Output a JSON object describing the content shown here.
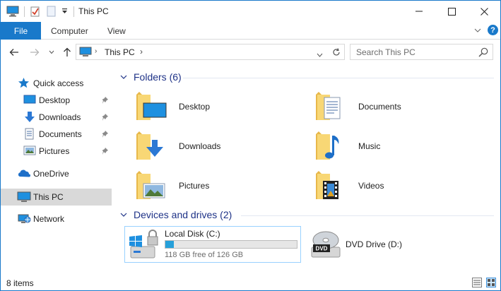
{
  "window": {
    "title": "This PC"
  },
  "window_controls": {
    "minimize": "—",
    "maximize": "☐",
    "close": "✕"
  },
  "ribbon": {
    "tabs": [
      {
        "label": "File"
      },
      {
        "label": "Computer"
      },
      {
        "label": "View"
      }
    ],
    "help": "?"
  },
  "nav": {
    "address": {
      "path": [
        "This PC"
      ]
    },
    "search": {
      "placeholder": "Search This PC"
    }
  },
  "sidebar": {
    "quick_access": "Quick access",
    "items": [
      {
        "label": "Desktop"
      },
      {
        "label": "Downloads"
      },
      {
        "label": "Documents"
      },
      {
        "label": "Pictures"
      }
    ],
    "onedrive": "OneDrive",
    "this_pc": "This PC",
    "network": "Network"
  },
  "content": {
    "folders_header": "Folders (6)",
    "folders": [
      {
        "label": "Desktop",
        "icon": "desktop-folder-icon"
      },
      {
        "label": "Documents",
        "icon": "documents-folder-icon"
      },
      {
        "label": "Downloads",
        "icon": "downloads-folder-icon"
      },
      {
        "label": "Music",
        "icon": "music-folder-icon"
      },
      {
        "label": "Pictures",
        "icon": "pictures-folder-icon"
      },
      {
        "label": "Videos",
        "icon": "videos-folder-icon"
      }
    ],
    "devices_header": "Devices and drives (2)",
    "drives": [
      {
        "label": "Local Disk (C:)",
        "free_text": "118 GB free of 126 GB",
        "used_fraction": 0.064
      },
      {
        "label": "DVD Drive (D:)",
        "badge": "DVD"
      }
    ]
  },
  "status": {
    "items": "8 items"
  },
  "colors": {
    "accent": "#1979ca",
    "header": "#1e3287",
    "folder": "#f8d775",
    "bar": "#26a0da"
  }
}
